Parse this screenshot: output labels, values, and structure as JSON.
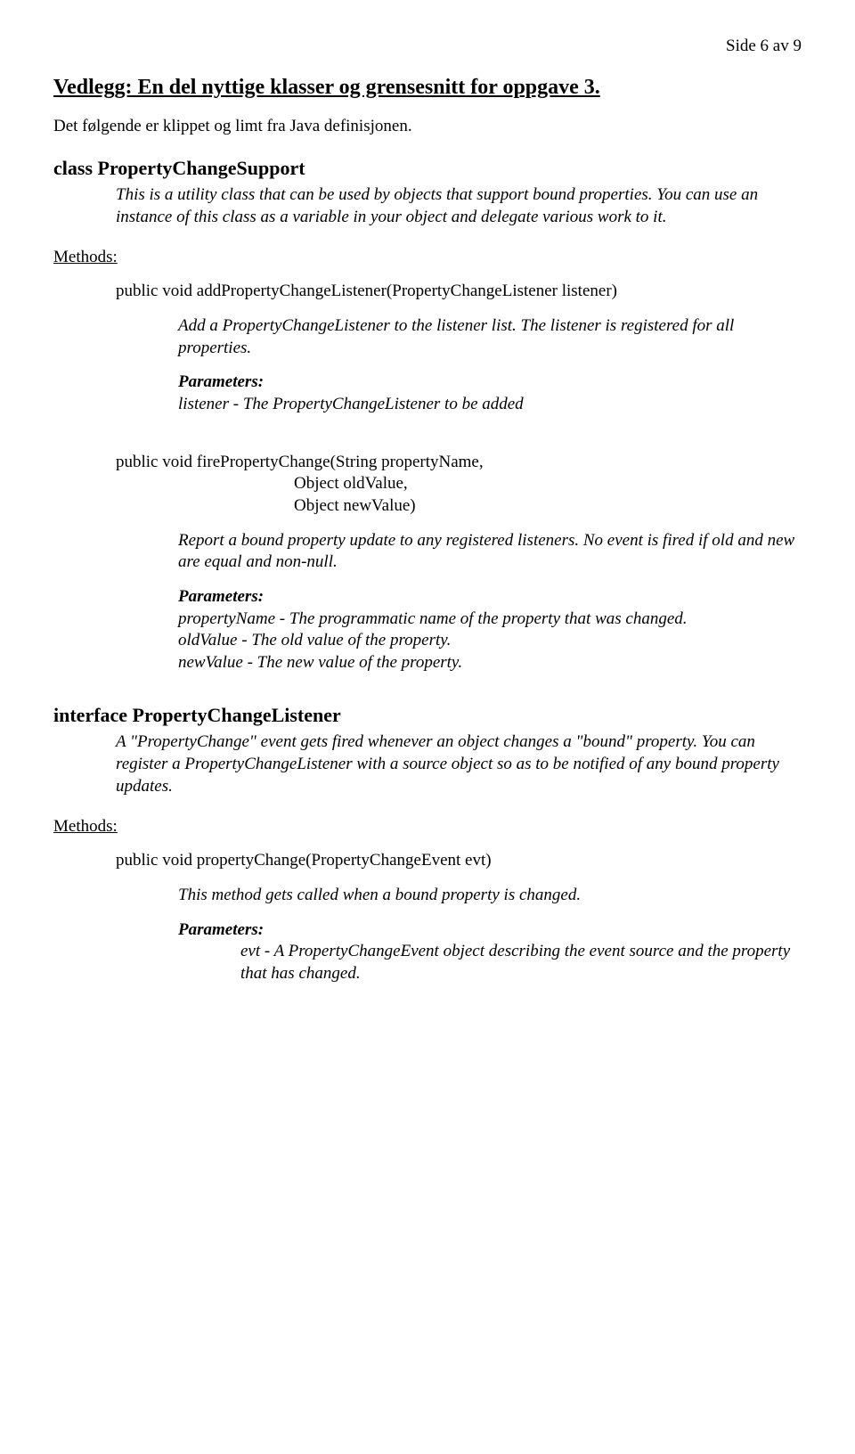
{
  "page_header": "Side 6 av 9",
  "title": "Vedlegg: En del nyttige klasser og grensesnitt for oppgave 3.",
  "subtitle": "Det følgende er klippet og limt fra Java definisjonen.",
  "class1": {
    "name": "class PropertyChangeSupport",
    "desc": "This is a utility class that can be used by objects that support bound properties. You can use an instance of this class as a variable in your object and delegate various work to it."
  },
  "methods_label": "Methods:",
  "method1": {
    "sig": "public void addPropertyChangeListener(PropertyChangeListener listener)",
    "desc": "Add a PropertyChangeListener to the listener list. The listener is registered for all properties.",
    "params_label": "Parameters:",
    "param1": "listener - The PropertyChangeListener to be added"
  },
  "method2": {
    "sig_line1": "public void firePropertyChange(String propertyName,",
    "sig_line2": "Object oldValue,",
    "sig_line3": "Object newValue)",
    "desc": "Report a bound property update to any registered listeners. No event is fired if old and new are equal and non-null.",
    "params_label": "Parameters:",
    "param1": "propertyName - The programmatic name of the property that was changed.",
    "param2": "oldValue - The old value of the property.",
    "param3": "newValue - The new value of the property."
  },
  "interface1": {
    "name": "interface PropertyChangeListener",
    "desc": "A \"PropertyChange\" event gets fired whenever an object changes a \"bound\" property. You can register a PropertyChangeListener with a source object so as to be notified of any bound property updates."
  },
  "method3": {
    "sig": "public void propertyChange(PropertyChangeEvent evt)",
    "desc": "This method gets called when a bound property is changed.",
    "params_label": "Parameters:",
    "param1": "evt - A PropertyChangeEvent object describing the event source and the property that has changed."
  }
}
